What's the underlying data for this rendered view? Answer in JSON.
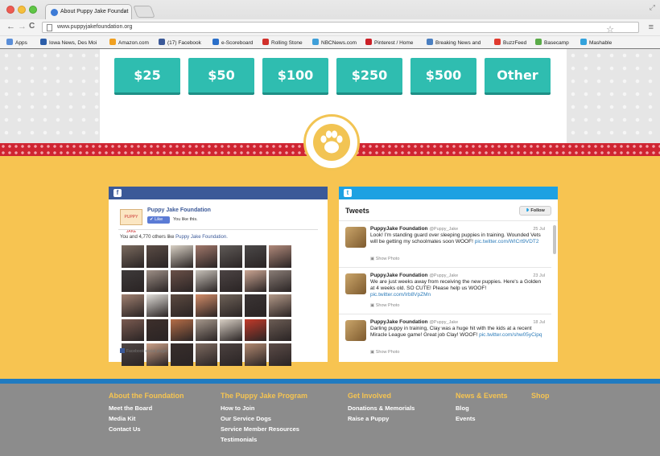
{
  "browser": {
    "tab_title": "About Puppy Jake Foundat",
    "tab_close": "×",
    "url": "www.puppyjakefoundation.org",
    "bookmarks": [
      {
        "label": "Apps",
        "color": "#5a8ed8"
      },
      {
        "label": "Iowa News, Des Moi",
        "color": "#2b5da8"
      },
      {
        "label": "Amazon.com",
        "color": "#f0a020"
      },
      {
        "label": "(17) Facebook",
        "color": "#3b5998"
      },
      {
        "label": "e-Scoreboard",
        "color": "#2a6fc9"
      },
      {
        "label": "Rolling Stone",
        "color": "#d1302b"
      },
      {
        "label": "NBCNews.com",
        "color": "#3f9fd9"
      },
      {
        "label": "Pinterest / Home",
        "color": "#cb2027"
      },
      {
        "label": "Breaking News and",
        "color": "#4a7fc1"
      },
      {
        "label": "BuzzFeed",
        "color": "#e03a2e"
      },
      {
        "label": "Basecamp",
        "color": "#5aab48"
      },
      {
        "label": "Mashable",
        "color": "#33a2dc"
      }
    ]
  },
  "donation": {
    "amounts": [
      "$25",
      "$50",
      "$100",
      "$250",
      "$500",
      "Other"
    ],
    "button_color": "#2fbdb0"
  },
  "facebook": {
    "icon": "f",
    "logo_text": "PUPPY JAKE",
    "page_name": "Puppy Jake Foundation",
    "like_label": "✔ Like",
    "you_like": "You like this.",
    "others_prefix": "You and 4,770 others like ",
    "others_link": "Puppy Jake Foundation.",
    "plugin_text": "Facebook social plugin",
    "face_colors": [
      "#7a6a5e",
      "#5a4c45",
      "#d8d0c4",
      "#a0776a",
      "#5f5a57",
      "#4b4848",
      "#b0897a",
      "#3e3a3a",
      "#9d8f86",
      "#6a5048",
      "#c6c0b8",
      "#4c4444",
      "#c9a492",
      "#8a7d76",
      "#a08070",
      "#e0ddd8",
      "#5c4a40",
      "#d28c68",
      "#6e6258",
      "#3a3434",
      "#b39988",
      "#7a5a50",
      "#3d2f2b",
      "#b56d47",
      "#a6988c",
      "#d8cfc4",
      "#c23a2a",
      "#6b5c54",
      "#504644",
      "#caa088",
      "#382e2c",
      "#7d6a60",
      "#4c4240",
      "#b08870",
      "#5c4c48"
    ]
  },
  "twitter": {
    "icon": "t",
    "title": "Tweets",
    "follow_label": "Follow",
    "tweets": [
      {
        "name": "PuppyJake Foundation",
        "handle": "@Puppy_Jake",
        "date": "25 Jul",
        "text": "Look! I'm standing guard over sleeping puppies in training. Wounded Vets will be getting my schoolmates soon WOOF!",
        "link": "pic.twitter.com/WICrt9VDT2",
        "photo": "Show Photo"
      },
      {
        "name": "PuppyJake Foundation",
        "handle": "@Puppy_Jake",
        "date": "23 Jul",
        "text": "We are just weeks away from receiving the new puppies. Here's a Golden at 4 weeks old. SO CUTE! Please help us WOOF!",
        "link": "pic.twitter.com/Irb8VpZMn",
        "photo": "Show Photo"
      },
      {
        "name": "PuppyJake Foundation",
        "handle": "@Puppy_Jake",
        "date": "18 Jul",
        "text": "Darling puppy in training, Clay was a huge hit with the kids at a recent Miracle League game! Great job Clay! WOOF!",
        "link": "pic.twitter.com/shw05yCipq",
        "photo": "Show Photo"
      }
    ]
  },
  "footer": {
    "columns": [
      {
        "heading": "About the Foundation",
        "links": [
          "Meet the Board",
          "Media Kit",
          "Contact Us"
        ]
      },
      {
        "heading": "The Puppy Jake Program",
        "links": [
          "How to Join",
          "Our Service Dogs",
          "Service Member Resources",
          "Testimonials"
        ]
      },
      {
        "heading": "Get Involved",
        "links": [
          "Donations & Memorials",
          "Raise a Puppy"
        ]
      },
      {
        "heading": "News & Events",
        "links": [
          "Blog",
          "Events"
        ]
      },
      {
        "heading": "Shop",
        "links": []
      }
    ]
  }
}
